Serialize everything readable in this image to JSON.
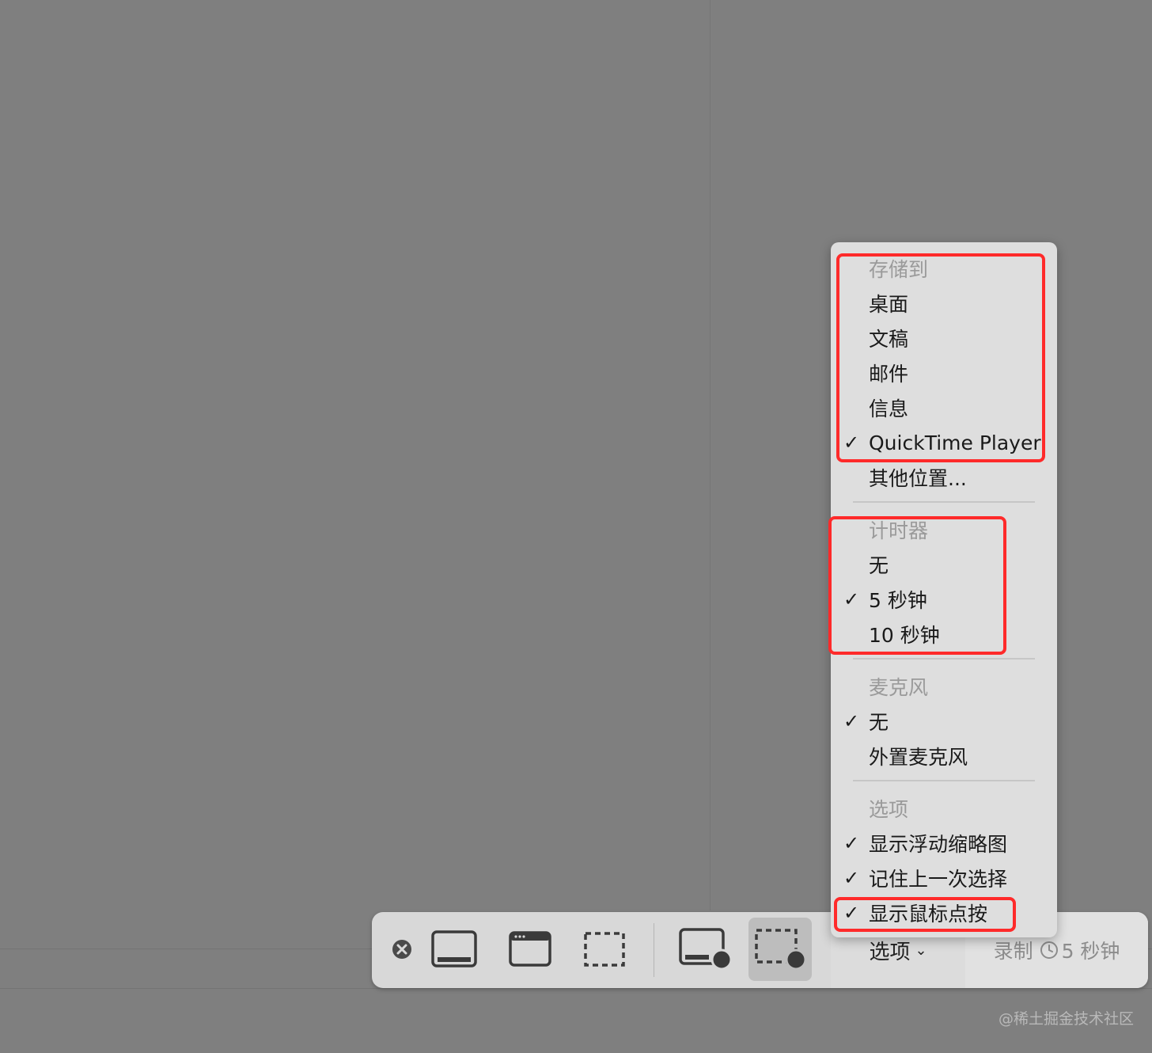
{
  "menu": {
    "save_header": "存储到",
    "save_items": [
      {
        "label": "桌面",
        "checked": false
      },
      {
        "label": "文稿",
        "checked": false
      },
      {
        "label": "邮件",
        "checked": false
      },
      {
        "label": "信息",
        "checked": false
      },
      {
        "label": "QuickTime Player",
        "checked": true
      },
      {
        "label": "其他位置...",
        "checked": false
      }
    ],
    "timer_header": "计时器",
    "timer_items": [
      {
        "label": "无",
        "checked": false
      },
      {
        "label": "5 秒钟",
        "checked": true
      },
      {
        "label": "10 秒钟",
        "checked": false
      }
    ],
    "mic_header": "麦克风",
    "mic_items": [
      {
        "label": "无",
        "checked": true
      },
      {
        "label": "外置麦克风",
        "checked": false
      }
    ],
    "options_header": "选项",
    "options_items": [
      {
        "label": "显示浮动缩略图",
        "checked": true
      },
      {
        "label": "记住上一次选择",
        "checked": true
      },
      {
        "label": "显示鼠标点按",
        "checked": true
      }
    ],
    "check_glyph": "✓"
  },
  "toolbar": {
    "options_label": "选项",
    "options_chevron": "⌄",
    "record_label": "录制",
    "record_timer": "5 秒钟",
    "icons": [
      "close-icon",
      "capture-entire-screen-icon",
      "capture-window-icon",
      "capture-selection-icon",
      "record-entire-screen-icon",
      "record-selection-icon"
    ]
  },
  "watermark": "@稀土掘金技术社区",
  "colors": {
    "highlight": "#ff2a2a",
    "background": "#7f7f7f",
    "menu_bg": "#dedede"
  }
}
